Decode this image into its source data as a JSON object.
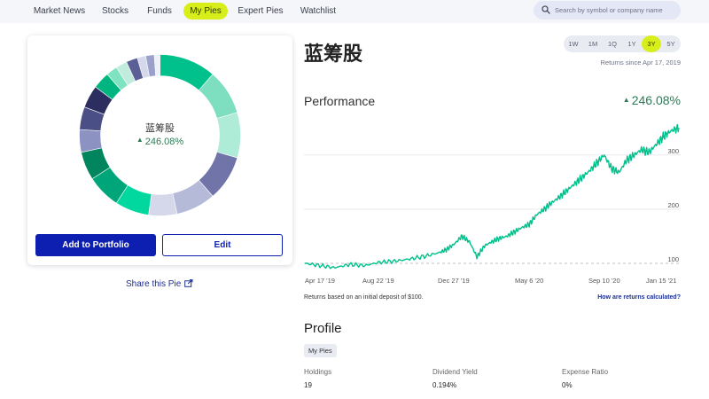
{
  "nav": {
    "items": [
      {
        "label": "Market News"
      },
      {
        "label": "Stocks"
      },
      {
        "label": "Funds"
      },
      {
        "label": "My Pies",
        "active": true
      },
      {
        "label": "Expert Pies"
      },
      {
        "label": "Watchlist"
      }
    ],
    "search_placeholder": "Search by symbol or company name"
  },
  "pie_card": {
    "name": "蓝筹股",
    "return_value": "246.08%",
    "add_button": "Add to Portfolio",
    "edit_button": "Edit",
    "segments": [
      {
        "value": 10,
        "color": "#00c08b"
      },
      {
        "value": 8,
        "color": "#7ddfbf"
      },
      {
        "value": 8,
        "color": "#aeecd7"
      },
      {
        "value": 8,
        "color": "#7074a8"
      },
      {
        "value": 7,
        "color": "#b4bad8"
      },
      {
        "value": 5,
        "color": "#d4d8ea"
      },
      {
        "value": 6,
        "color": "#00d8a0"
      },
      {
        "value": 6,
        "color": "#00a67a"
      },
      {
        "value": 5,
        "color": "#00855e"
      },
      {
        "value": 4,
        "color": "#8c93c2"
      },
      {
        "value": 4,
        "color": "#4a4f86"
      },
      {
        "value": 4,
        "color": "#2c2e5f"
      },
      {
        "value": 3,
        "color": "#00b57f"
      },
      {
        "value": 2,
        "color": "#7fe3c2"
      },
      {
        "value": 2,
        "color": "#c0ebdd"
      },
      {
        "value": 2,
        "color": "#5a5f95"
      },
      {
        "value": 1.5,
        "color": "#d4d8ea"
      },
      {
        "value": 1.5,
        "color": "#9aa0c9"
      },
      {
        "value": 1,
        "color": "#eef0f7"
      }
    ]
  },
  "share_label": "Share this Pie",
  "title": "蓝筹股",
  "ranges": [
    {
      "label": "1W"
    },
    {
      "label": "1M"
    },
    {
      "label": "1Q"
    },
    {
      "label": "1Y"
    },
    {
      "label": "3Y",
      "active": true
    },
    {
      "label": "5Y"
    }
  ],
  "returns_since": "Returns since Apr 17, 2019",
  "performance": {
    "label": "Performance",
    "value": "246.08%"
  },
  "chart_data": {
    "type": "line",
    "y_ticks": [
      100,
      200,
      300
    ],
    "ylim": [
      82,
      357
    ],
    "baseline": 100,
    "x_labels": [
      "Apr 17 '19",
      "Aug 22 '19",
      "Dec 27 '19",
      "May 6 '20",
      "Sep 10 '20",
      "Jan 15 '21"
    ],
    "x": [
      0,
      0.04,
      0.08,
      0.12,
      0.16,
      0.2,
      0.24,
      0.28,
      0.32,
      0.36,
      0.38,
      0.4,
      0.42,
      0.44,
      0.46,
      0.48,
      0.5,
      0.52,
      0.54,
      0.56,
      0.58,
      0.6,
      0.62,
      0.64,
      0.66,
      0.68,
      0.7,
      0.72,
      0.74,
      0.76,
      0.78,
      0.8,
      0.82,
      0.84,
      0.86,
      0.88,
      0.9,
      0.92,
      0.94,
      0.96,
      0.98,
      1.0
    ],
    "values": [
      100,
      96,
      92,
      98,
      96,
      102,
      104,
      108,
      113,
      120,
      126,
      136,
      150,
      140,
      112,
      132,
      140,
      146,
      150,
      158,
      166,
      172,
      190,
      200,
      212,
      222,
      234,
      246,
      258,
      270,
      285,
      300,
      275,
      268,
      290,
      300,
      310,
      305,
      320,
      335,
      345,
      350
    ],
    "color": "#00c08b"
  },
  "deposit_note": "Returns based on an initial deposit of $100.",
  "how_link": "How are returns calculated?",
  "profile": {
    "heading": "Profile",
    "badge": "My Pies",
    "stats": [
      {
        "label": "Holdings",
        "value": "19"
      },
      {
        "label": "Dividend Yield",
        "value": "0.194%"
      },
      {
        "label": "Expense Ratio",
        "value": "0%"
      }
    ]
  }
}
